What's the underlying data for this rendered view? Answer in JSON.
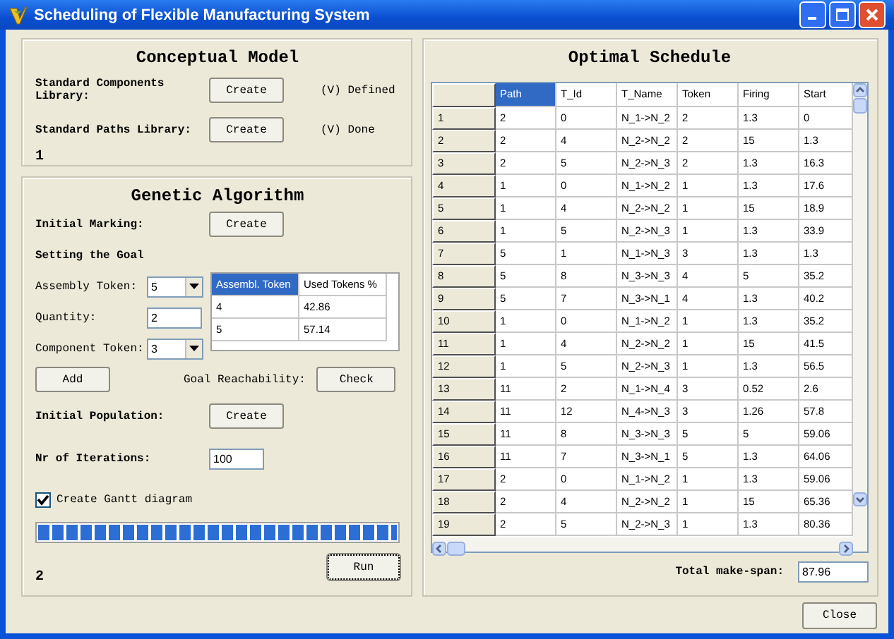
{
  "window": {
    "title": "Scheduling of Flexible Manufacturing System"
  },
  "conceptual_model": {
    "title": "Conceptual Model",
    "rows": [
      {
        "label": "Standard Components Library:",
        "button": "Create",
        "status": "(V) Defined"
      },
      {
        "label": "Standard Paths Library:",
        "button": "Create",
        "status": "(V) Done"
      }
    ],
    "number": "1"
  },
  "genetic_algorithm": {
    "title": "Genetic Algorithm",
    "initial_marking": {
      "label": "Initial Marking:",
      "button": "Create"
    },
    "goal_heading": "Setting the Goal",
    "assembly_token": {
      "label": "Assembly Token:",
      "value": "5"
    },
    "quantity": {
      "label": "Quantity:",
      "value": "2"
    },
    "component_token": {
      "label": "Component Token:",
      "value": "3"
    },
    "goal_table": {
      "columns": [
        {
          "label": "Assembl. Token",
          "selected": true
        },
        {
          "label": "Used Tokens %",
          "selected": false
        }
      ],
      "rows": [
        [
          "4",
          "42.86"
        ],
        [
          "5",
          "57.14"
        ]
      ]
    },
    "add_button": "Add",
    "goal_reachability": {
      "label": "Goal Reachability:",
      "button": "Check"
    },
    "initial_population": {
      "label": "Initial Population:",
      "button": "Create"
    },
    "iterations": {
      "label": "Nr of Iterations:",
      "value": "100"
    },
    "gantt": {
      "label": "Create Gantt diagram",
      "checked": true
    },
    "progress": {
      "level": 1
    },
    "run_button": "Run",
    "number": "2"
  },
  "optimal_schedule": {
    "title": "Optimal Schedule",
    "table": {
      "columns": [
        {
          "label": "Path",
          "selected": true
        },
        {
          "label": "T_Id",
          "selected": false
        },
        {
          "label": "T_Name",
          "selected": false
        },
        {
          "label": "Token",
          "selected": false
        },
        {
          "label": "Firing",
          "selected": false
        },
        {
          "label": "Start",
          "selected": false
        }
      ],
      "rows": [
        {
          "header": "1",
          "cells": [
            "2",
            "0",
            "N_1->N_2",
            "2",
            "1.3",
            "0"
          ]
        },
        {
          "header": "2",
          "cells": [
            "2",
            "4",
            "N_2->N_2",
            "2",
            "15",
            "1.3"
          ]
        },
        {
          "header": "3",
          "cells": [
            "2",
            "5",
            "N_2->N_3",
            "2",
            "1.3",
            "16.3"
          ]
        },
        {
          "header": "4",
          "cells": [
            "1",
            "0",
            "N_1->N_2",
            "1",
            "1.3",
            "17.6"
          ]
        },
        {
          "header": "5",
          "cells": [
            "1",
            "4",
            "N_2->N_2",
            "1",
            "15",
            "18.9"
          ]
        },
        {
          "header": "6",
          "cells": [
            "1",
            "5",
            "N_2->N_3",
            "1",
            "1.3",
            "33.9"
          ]
        },
        {
          "header": "7",
          "cells": [
            "5",
            "1",
            "N_1->N_3",
            "3",
            "1.3",
            "1.3"
          ]
        },
        {
          "header": "8",
          "cells": [
            "5",
            "8",
            "N_3->N_3",
            "4",
            "5",
            "35.2"
          ]
        },
        {
          "header": "9",
          "cells": [
            "5",
            "7",
            "N_3->N_1",
            "4",
            "1.3",
            "40.2"
          ]
        },
        {
          "header": "10",
          "cells": [
            "1",
            "0",
            "N_1->N_2",
            "1",
            "1.3",
            "35.2"
          ]
        },
        {
          "header": "11",
          "cells": [
            "1",
            "4",
            "N_2->N_2",
            "1",
            "15",
            "41.5"
          ]
        },
        {
          "header": "12",
          "cells": [
            "1",
            "5",
            "N_2->N_3",
            "1",
            "1.3",
            "56.5"
          ]
        },
        {
          "header": "13",
          "cells": [
            "11",
            "2",
            "N_1->N_4",
            "3",
            "0.52",
            "2.6"
          ]
        },
        {
          "header": "14",
          "cells": [
            "11",
            "12",
            "N_4->N_3",
            "3",
            "1.26",
            "57.8"
          ]
        },
        {
          "header": "15",
          "cells": [
            "11",
            "8",
            "N_3->N_3",
            "5",
            "5",
            "59.06"
          ]
        },
        {
          "header": "16",
          "cells": [
            "11",
            "7",
            "N_3->N_1",
            "5",
            "1.3",
            "64.06"
          ]
        },
        {
          "header": "17",
          "cells": [
            "2",
            "0",
            "N_1->N_2",
            "1",
            "1.3",
            "59.06"
          ]
        },
        {
          "header": "18",
          "cells": [
            "2",
            "4",
            "N_2->N_2",
            "1",
            "15",
            "65.36"
          ]
        },
        {
          "header": "19",
          "cells": [
            "2",
            "5",
            "N_2->N_3",
            "1",
            "1.3",
            "80.36"
          ]
        }
      ]
    },
    "make_span": {
      "label": "Total make-span:",
      "value": "87.96"
    }
  },
  "close_button": "Close"
}
